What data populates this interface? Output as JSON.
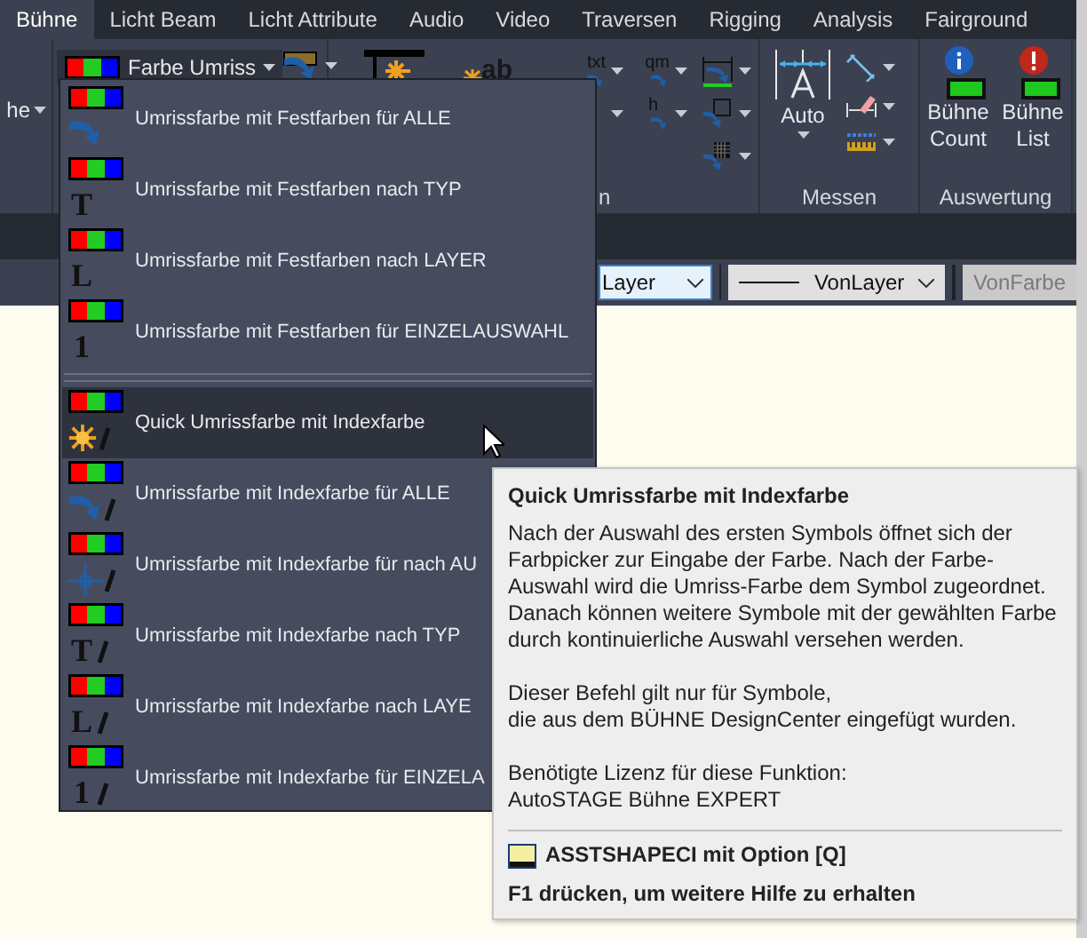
{
  "tabs": [
    {
      "label": "Bühne",
      "selected": true
    },
    {
      "label": "Licht Beam",
      "selected": false
    },
    {
      "label": "Licht Attribute",
      "selected": false
    },
    {
      "label": "Audio",
      "selected": false
    },
    {
      "label": "Video",
      "selected": false
    },
    {
      "label": "Traversen",
      "selected": false
    },
    {
      "label": "Rigging",
      "selected": false
    },
    {
      "label": "Analysis",
      "selected": false
    },
    {
      "label": "Fairground",
      "selected": false
    }
  ],
  "ribbon": {
    "left_panel_label": "he",
    "color_button": "Farbe Umriss",
    "icon_texts": [
      "ab",
      "txt",
      "qm",
      "h"
    ],
    "panel_labels": [
      "n",
      "Messen",
      "Auswertung"
    ],
    "auto_button": "Auto",
    "stat_buttons": [
      {
        "label": "Bühne Count",
        "kind": "info"
      },
      {
        "label": "Bühne List",
        "kind": "alert"
      }
    ]
  },
  "properties_bar": {
    "layer": "Layer",
    "linetype": "VonLayer",
    "color_field": "VonFarbe"
  },
  "menu": {
    "groups": [
      [
        {
          "label": "Umrissfarbe mit Festfarben für ALLE",
          "kind": "arrow",
          "index": false,
          "separator_before": false,
          "selected": false
        },
        {
          "label": "Umrissfarbe mit Festfarben nach TYP",
          "kind": "glyph",
          "glyph": "T",
          "index": false,
          "separator_before": false,
          "selected": false
        },
        {
          "label": "Umrissfarbe mit Festfarben nach LAYER",
          "kind": "glyph",
          "glyph": "L",
          "index": false,
          "separator_before": false,
          "selected": false
        },
        {
          "label": "Umrissfarbe mit Festfarben für EINZELAUSWAHL",
          "kind": "glyph",
          "glyph": "1",
          "index": false,
          "separator_before": false,
          "selected": false
        }
      ],
      [
        {
          "label": "Quick Umrissfarbe mit Indexfarbe",
          "kind": "sun",
          "index": true,
          "separator_before": true,
          "selected": true
        },
        {
          "label": "Umrissfarbe mit Indexfarbe für ALLE",
          "kind": "arrow",
          "index": true,
          "separator_before": false,
          "selected": false
        },
        {
          "label": "Umrissfarbe mit Indexfarbe für nach AU",
          "kind": "cross",
          "index": true,
          "separator_before": false,
          "selected": false
        },
        {
          "label": "Umrissfarbe mit Indexfarbe nach TYP",
          "kind": "glyph",
          "glyph": "T",
          "index": true,
          "separator_before": false,
          "selected": false
        },
        {
          "label": "Umrissfarbe mit Indexfarbe nach LAYE",
          "kind": "glyph",
          "glyph": "L",
          "index": true,
          "separator_before": false,
          "selected": false
        },
        {
          "label": "Umrissfarbe mit Indexfarbe für EINZELA",
          "kind": "glyph",
          "glyph": "1",
          "index": true,
          "separator_before": false,
          "selected": false
        }
      ]
    ]
  },
  "tooltip": {
    "title": "Quick Umrissfarbe mit Indexfarbe",
    "paragraphs": [
      [
        "Nach der Auswahl des ersten Symbols öffnet sich der Farbpicker zur Eingabe der Farbe. Nach der Farbe-Auswahl wird die Umriss-Farbe dem Symbol zugeordnet. Danach können weitere Symbole mit der gewählten Farbe durch kontinuierliche Auswahl versehen werden."
      ],
      [
        "Dieser Befehl gilt nur für Symbole,",
        "die aus dem BÜHNE DesignCenter eingefügt wurden."
      ],
      [
        "Benötigte Lizenz für diese Funktion:",
        "AutoSTAGE Bühne EXPERT"
      ]
    ],
    "command": "ASSTSHAPECI mit Option [Q]",
    "help": "F1 drücken, um weitere Hilfe zu erhalten"
  }
}
